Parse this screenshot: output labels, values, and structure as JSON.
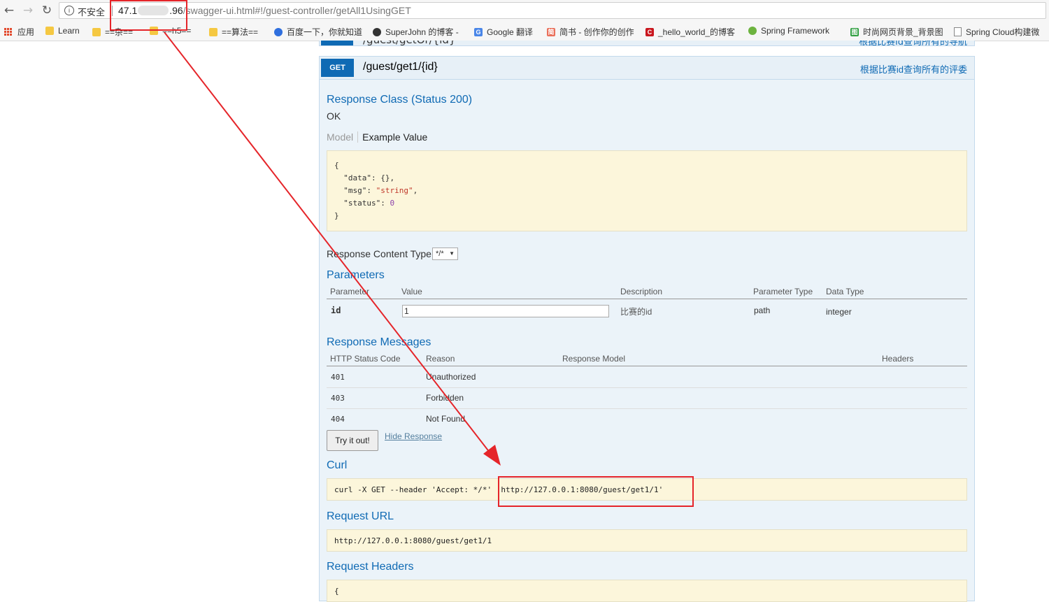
{
  "browser": {
    "security_label": "不安全",
    "url_host_prefix": "47.1",
    "url_host_suffix": ".96",
    "url_path": "/swagger-ui.html#!/guest-controller/getAll1UsingGET",
    "bookmarks": [
      {
        "label": "应用"
      },
      {
        "label": "Learn"
      },
      {
        "label": "==杂=="
      },
      {
        "label": "==h5=="
      },
      {
        "label": "==算法=="
      },
      {
        "label": "百度一下，你就知道"
      },
      {
        "label": "SuperJohn 的博客 -"
      },
      {
        "label": "Google 翻译"
      },
      {
        "label": "简书 - 创作你的创作"
      },
      {
        "label": "_hello_world_的博客"
      },
      {
        "label": "Spring Framework"
      },
      {
        "label": "时尚网页背景_背景图"
      },
      {
        "label": "Spring Cloud构建微"
      }
    ]
  },
  "prev_operation": {
    "method": "GET",
    "path": "/guest/getOr/{id}",
    "summary": "根据比赛id查询所有的导航"
  },
  "operation": {
    "method": "GET",
    "path": "/guest/get1/{id}",
    "summary": "根据比赛id查询所有的评委",
    "response_class_title": "Response Class (Status 200)",
    "response_class_text": "OK",
    "tab_model": "Model",
    "tab_example": "Example Value",
    "example_lines": {
      "open": "{",
      "data_key": "\"data\"",
      "data_val": ": {},",
      "msg_key": "\"msg\"",
      "msg_val": "\"string\"",
      "status_key": "\"status\"",
      "status_val": "0",
      "close": "}"
    },
    "response_content_type_label": "Response Content Type",
    "response_content_type_value": "*/*",
    "parameters_title": "Parameters",
    "param_headers": {
      "parameter": "Parameter",
      "value": "Value",
      "description": "Description",
      "parameter_type": "Parameter Type",
      "data_type": "Data Type"
    },
    "param_row": {
      "name": "id",
      "value": "1",
      "description": "比赛的id",
      "parameter_type": "path",
      "data_type": "integer"
    },
    "response_messages_title": "Response Messages",
    "msg_headers": {
      "code": "HTTP Status Code",
      "reason": "Reason",
      "model": "Response Model",
      "headers": "Headers"
    },
    "msg_rows": [
      {
        "code": "401",
        "reason": "Unauthorized"
      },
      {
        "code": "403",
        "reason": "Forbidden"
      },
      {
        "code": "404",
        "reason": "Not Found"
      }
    ],
    "try_button": "Try it out!",
    "hide_response": "Hide Response",
    "curl_title": "Curl",
    "curl_prefix": "curl -X GET --header 'Accept: */*' ",
    "curl_url": "'http://127.0.0.1:8080/guest/get1/1'",
    "request_url_title": "Request URL",
    "request_url": "http://127.0.0.1:8080/guest/get1/1",
    "request_headers_title": "Request Headers",
    "request_headers_preview": "{"
  },
  "colors": {
    "accent": "#0f6ab4",
    "annotation": "#e5252a",
    "code_bg": "#fcf6db"
  }
}
